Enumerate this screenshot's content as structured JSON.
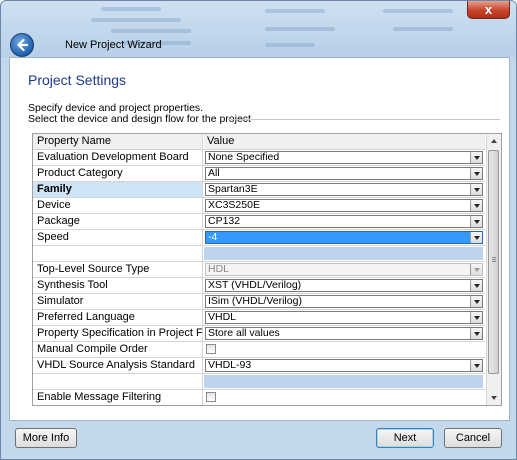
{
  "window": {
    "title": "New Project Wizard",
    "close_glyph": "x"
  },
  "page": {
    "title": "Project Settings",
    "description_line1": "Specify device and project properties.",
    "description_line2": "Select the device and design flow for the project"
  },
  "grid": {
    "header": {
      "name": "Property Name",
      "value": "Value"
    },
    "rows": [
      {
        "name": "Evaluation Development Board",
        "value": "None Specified"
      },
      {
        "name": "Product Category",
        "value": "All"
      },
      {
        "name": "Family",
        "value": "Spartan3E"
      },
      {
        "name": "Device",
        "value": "XC3S250E"
      },
      {
        "name": "Package",
        "value": "CP132"
      },
      {
        "name": "Speed",
        "value": "-4"
      },
      {
        "name": "Top-Level Source Type",
        "value": "HDL"
      },
      {
        "name": "Synthesis Tool",
        "value": "XST (VHDL/Verilog)"
      },
      {
        "name": "Simulator",
        "value": "ISim (VHDL/Verilog)"
      },
      {
        "name": "Preferred Language",
        "value": "VHDL"
      },
      {
        "name": "Property Specification in Project File",
        "value": "Store all values"
      },
      {
        "name": "Manual Compile Order",
        "value": ""
      },
      {
        "name": "VHDL Source Analysis Standard",
        "value": "VHDL-93"
      },
      {
        "name": "Enable Message Filtering",
        "value": ""
      }
    ]
  },
  "buttons": {
    "more_info": "More Info",
    "next": "Next",
    "cancel": "Cancel"
  },
  "icons": {
    "back": "back-arrow-icon",
    "close": "close-icon"
  }
}
